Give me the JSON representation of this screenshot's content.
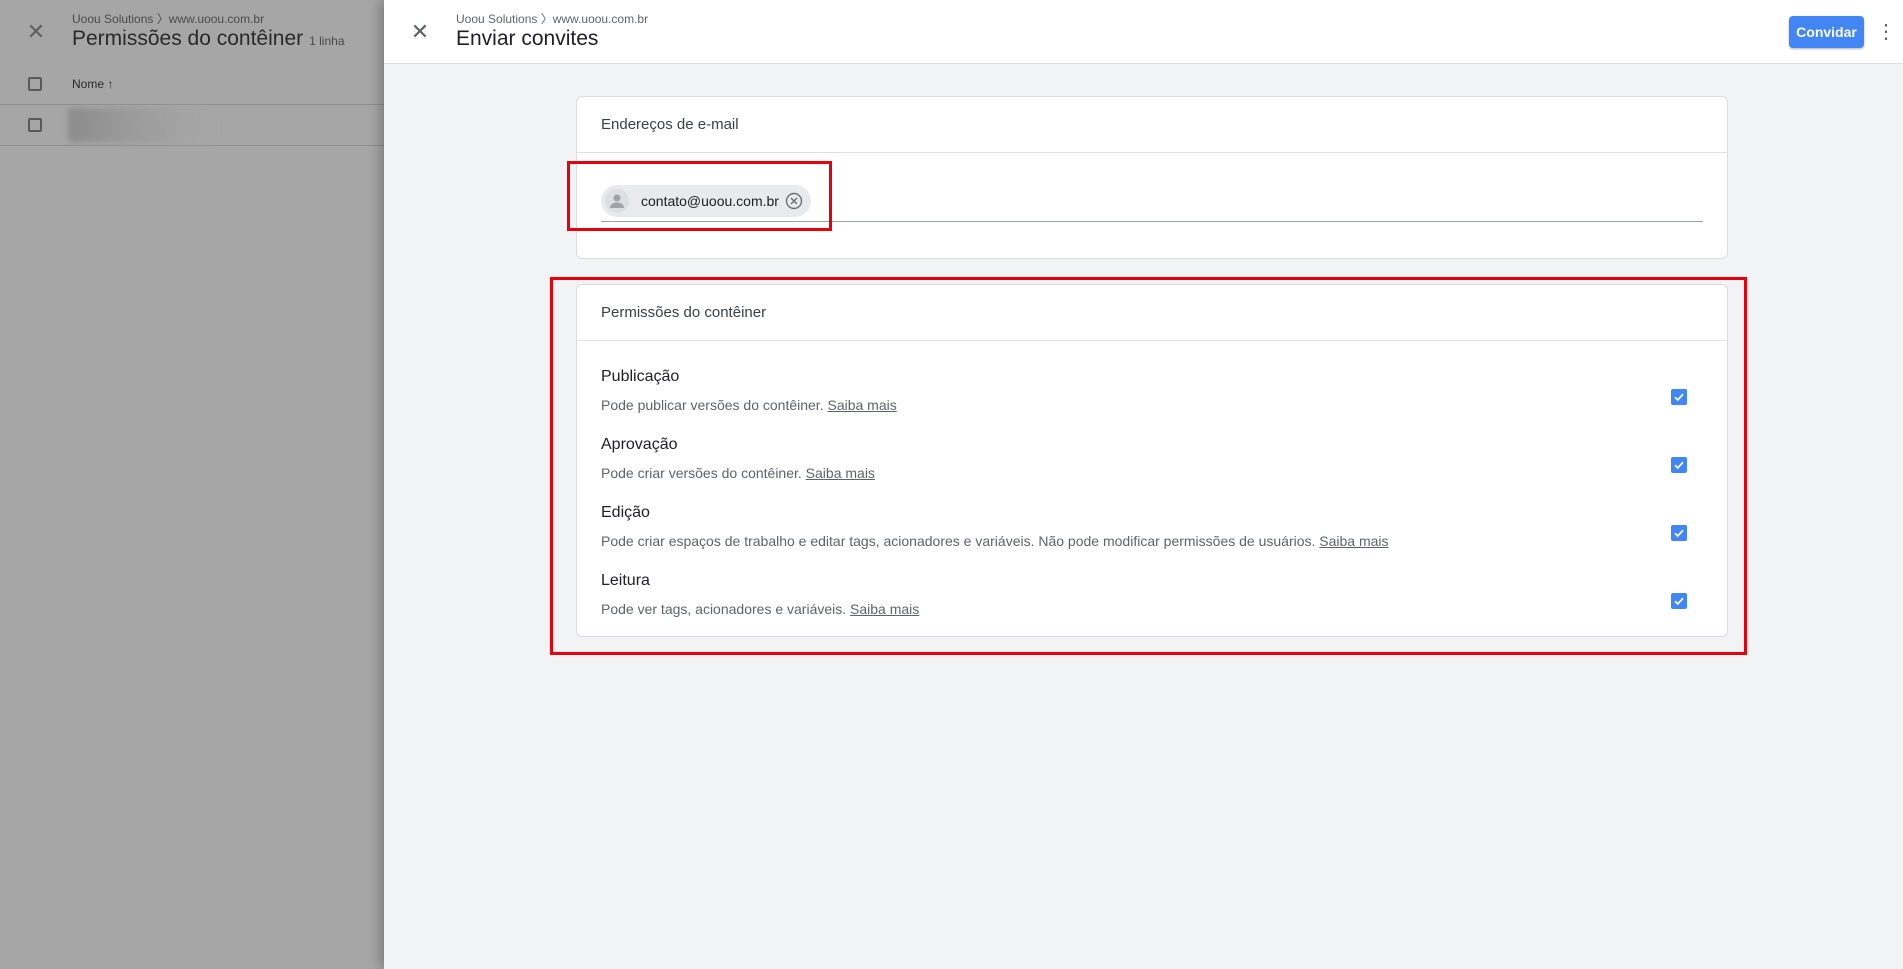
{
  "background": {
    "breadcrumb": "Uoou Solutions 〉www.uoou.com.br",
    "title": "Permissões do contêiner",
    "count": "1 linha",
    "table": {
      "column_name": "Nome ↑"
    }
  },
  "panel": {
    "breadcrumb": "Uoou Solutions 〉www.uoou.com.br",
    "title": "Enviar convites",
    "invite_label": "Convidar",
    "email_section": {
      "heading": "Endereços de e-mail",
      "chips": [
        "contato@uoou.com.br"
      ]
    },
    "permissions_section": {
      "heading": "Permissões do contêiner",
      "learn_more": "Saiba mais",
      "items": [
        {
          "name": "Publicação",
          "description": "Pode publicar versões do contêiner.",
          "checked": true
        },
        {
          "name": "Aprovação",
          "description": "Pode criar versões do contêiner.",
          "checked": true
        },
        {
          "name": "Edição",
          "description": "Pode criar espaços de trabalho e editar tags, acionadores e variáveis. Não pode modificar permissões de usuários.",
          "checked": true
        },
        {
          "name": "Leitura",
          "description": "Pode ver tags, acionadores e variáveis.",
          "checked": true
        }
      ]
    }
  },
  "colors": {
    "accent": "#4285f4",
    "highlight": "#e8000b"
  }
}
